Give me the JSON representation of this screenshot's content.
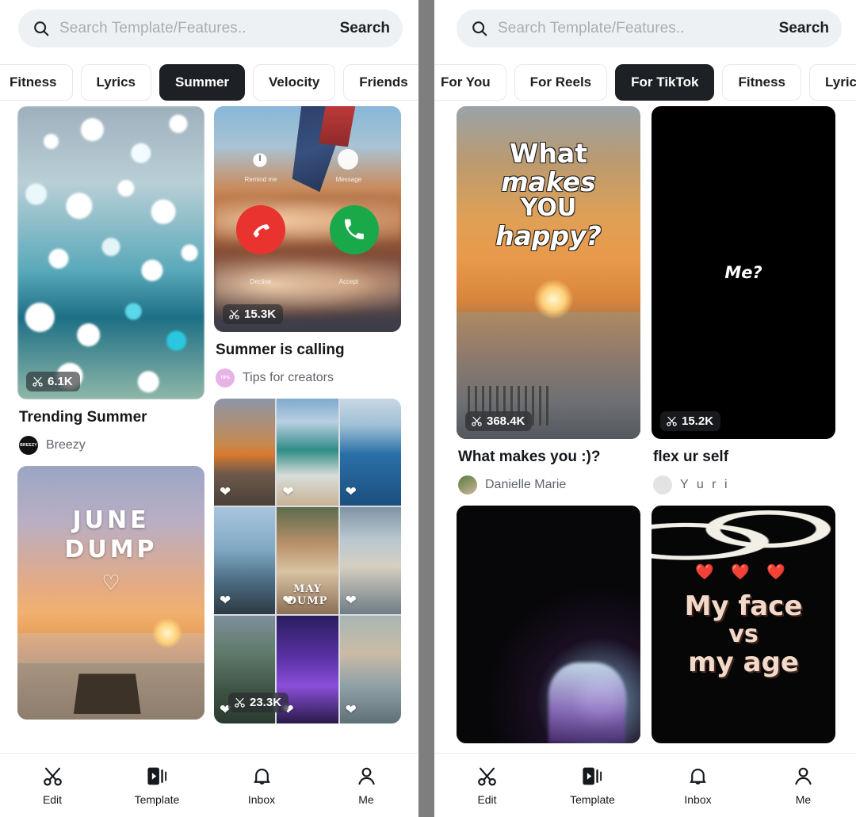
{
  "app": {
    "divider_color": "#7e7e7e",
    "accent_dark": "#1d2024"
  },
  "panels": [
    {
      "id": "left",
      "search": {
        "placeholder": "Search Template/Features..",
        "button_label": "Search",
        "icon": "search-icon"
      },
      "chips": [
        {
          "label": "Fitness",
          "active": false
        },
        {
          "label": "Lyrics",
          "active": false
        },
        {
          "label": "Summer",
          "active": true
        },
        {
          "label": "Velocity",
          "active": false
        },
        {
          "label": "Friends",
          "active": false
        }
      ],
      "cards": [
        {
          "art": "bokeh",
          "clips": "6.1K",
          "title": "Trending Summer",
          "author": "Breezy",
          "avatar_label": "BREEZY",
          "avatar_color": "#111111"
        },
        {
          "art": "june",
          "clips": "",
          "title": "",
          "author": "",
          "overlay": {
            "line1": "JUNE",
            "line2": "DUMP",
            "heart": "♡"
          }
        },
        {
          "art": "plane",
          "clips": "15.3K",
          "title": "Summer is calling",
          "author": "Tips for creators",
          "avatar_label": "TIPS",
          "avatar_color": "#e6b3e6",
          "call_ui": {
            "remind_label": "Remind me",
            "message_label": "Message",
            "decline_label": "Decline",
            "accept_label": "Accept"
          }
        },
        {
          "art": "collage",
          "clips": "23.3K",
          "title": "",
          "author": "",
          "overlay": {
            "line1": "MAY",
            "line2": "DUMP"
          }
        }
      ]
    },
    {
      "id": "right",
      "search": {
        "placeholder": "Search Template/Features..",
        "button_label": "Search",
        "icon": "search-icon"
      },
      "chips": [
        {
          "label": "For You",
          "active": false
        },
        {
          "label": "For Reels",
          "active": false
        },
        {
          "label": "For TikTok",
          "active": true
        },
        {
          "label": "Fitness",
          "active": false
        },
        {
          "label": "Lyrics",
          "active": false
        }
      ],
      "cards": [
        {
          "art": "happy",
          "clips": "368.4K",
          "title": "What makes you :)?",
          "author": "Danielle Marie",
          "avatar_label": "",
          "avatar_color": "#4a6b3a",
          "overlay": {
            "line1": "What",
            "line2": "makes",
            "line3": "YOU",
            "line4": "happy?"
          }
        },
        {
          "art": "black",
          "clips": "15.2K",
          "title": "flex ur self",
          "author": "Y u r i",
          "author_spaced": true,
          "avatar_label": "",
          "avatar_color": "#d8d8d8",
          "overlay": {
            "line1": "Me?"
          }
        },
        {
          "art": "dark",
          "clips": "",
          "title": "",
          "author": ""
        },
        {
          "art": "face",
          "clips": "",
          "title": "",
          "author": "",
          "overlay": {
            "line1": "My face",
            "line2": "vs",
            "line3": "my age",
            "hearts": "❤️ ❤️ ❤️"
          }
        }
      ]
    }
  ],
  "bottom_nav": {
    "items": [
      {
        "label": "Edit",
        "icon": "scissors-icon",
        "active": false
      },
      {
        "label": "Template",
        "icon": "video-template-icon",
        "active": true
      },
      {
        "label": "Inbox",
        "icon": "bell-icon",
        "active": false
      },
      {
        "label": "Me",
        "icon": "person-icon",
        "active": false
      }
    ]
  }
}
